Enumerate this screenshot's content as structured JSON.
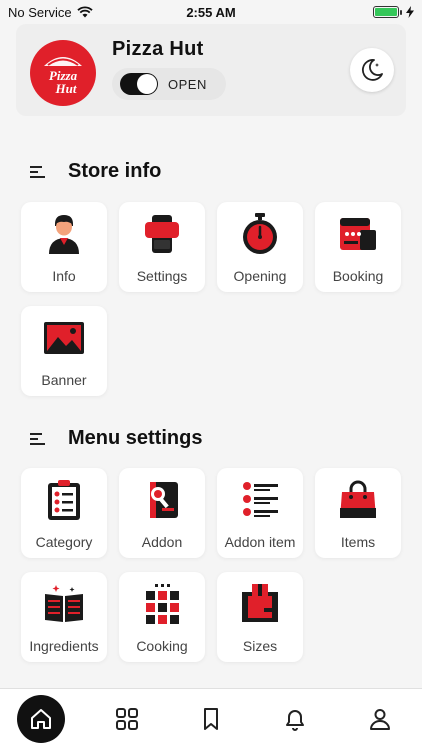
{
  "status_bar": {
    "carrier": "No Service",
    "time": "2:55 AM"
  },
  "header": {
    "store_name": "Pizza Hut",
    "logo_text": "Pizza Hut",
    "status_label": "OPEN",
    "is_open": true
  },
  "store_info": {
    "title": "Store info",
    "items": [
      {
        "label": "Info",
        "icon": "person-icon"
      },
      {
        "label": "Settings",
        "icon": "phone-settings-icon"
      },
      {
        "label": "Opening",
        "icon": "stopwatch-icon"
      },
      {
        "label": "Booking",
        "icon": "booking-icon"
      },
      {
        "label": "Banner",
        "icon": "image-icon"
      }
    ]
  },
  "menu_settings": {
    "title": "Menu settings",
    "items": [
      {
        "label": "Category",
        "icon": "clipboard-icon"
      },
      {
        "label": "Addon",
        "icon": "addon-book-icon"
      },
      {
        "label": "Addon item",
        "icon": "list-icon"
      },
      {
        "label": "Items",
        "icon": "shopping-bag-icon"
      },
      {
        "label": "Ingredients",
        "icon": "open-book-icon"
      },
      {
        "label": "Cooking",
        "icon": "grid-dots-icon"
      },
      {
        "label": "Sizes",
        "icon": "box-icon"
      }
    ]
  },
  "colors": {
    "accent": "#e0202a",
    "dark": "#1a1a1a",
    "background": "#f5f5f5"
  },
  "bottom_nav": [
    "home-icon",
    "grid-icon",
    "bookmark-icon",
    "bell-icon",
    "user-icon"
  ]
}
